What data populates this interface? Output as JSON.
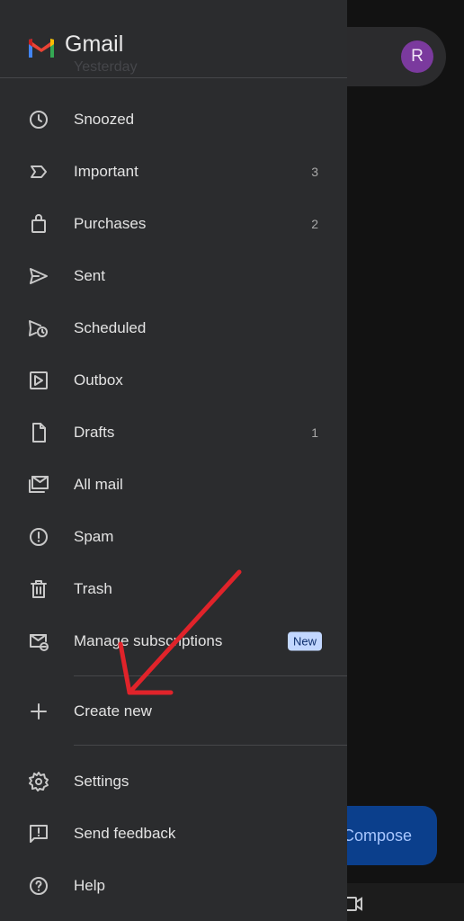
{
  "background": {
    "avatar_letter": "R",
    "compose_label": "Compose"
  },
  "drawer": {
    "brand": "Gmail",
    "ghost_text": "Yesterday",
    "items": [
      {
        "label": "Snoozed",
        "count": "",
        "icon": "clock-icon"
      },
      {
        "label": "Important",
        "count": "3",
        "icon": "important-icon"
      },
      {
        "label": "Purchases",
        "count": "2",
        "icon": "shopping-bag-icon"
      },
      {
        "label": "Sent",
        "count": "",
        "icon": "send-icon"
      },
      {
        "label": "Scheduled",
        "count": "",
        "icon": "scheduled-send-icon"
      },
      {
        "label": "Outbox",
        "count": "",
        "icon": "outbox-icon"
      },
      {
        "label": "Drafts",
        "count": "1",
        "icon": "draft-icon"
      },
      {
        "label": "All mail",
        "count": "",
        "icon": "all-mail-icon"
      },
      {
        "label": "Spam",
        "count": "",
        "icon": "spam-icon"
      },
      {
        "label": "Trash",
        "count": "",
        "icon": "trash-icon"
      },
      {
        "label": "Manage subscriptions",
        "badge": "New",
        "icon": "manage-subscriptions-icon"
      }
    ],
    "create_new_label": "Create new",
    "bottom_items": [
      {
        "label": "Settings",
        "icon": "gear-icon"
      },
      {
        "label": "Send feedback",
        "icon": "feedback-icon"
      },
      {
        "label": "Help",
        "icon": "help-icon"
      }
    ]
  },
  "colors": {
    "drawer_bg": "#2b2c2e",
    "accent_badge": "#c2d7ff",
    "annotation_arrow": "#e0232a",
    "compose_bg": "#0b3f8c"
  }
}
